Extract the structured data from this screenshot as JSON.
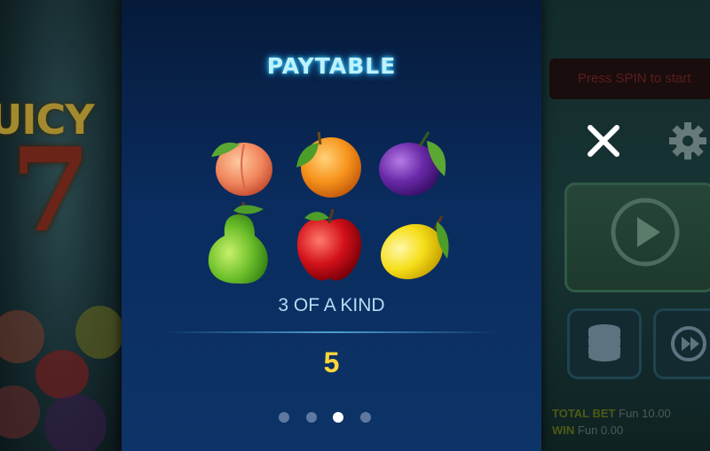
{
  "background": {
    "logo_text": "UICY",
    "logo_number": "7",
    "status_message": "Press SPIN to start",
    "total_bet_label": "TOTAL BET",
    "total_bet_value": "Fun 10.00",
    "win_label": "WIN",
    "win_value": "Fun 0.00"
  },
  "paytable": {
    "title": "PAYTABLE",
    "symbols": [
      "peach",
      "orange",
      "plum",
      "pear",
      "apple",
      "lemon"
    ],
    "combo_label": "3 OF A KIND",
    "payout": "5",
    "pages": 4,
    "current_page": 3
  },
  "colors": {
    "title_glow": "#3ad6ff",
    "payout": "#ffd53b",
    "panel": "#0a2c5e"
  },
  "icons": {
    "close": "close-icon",
    "settings": "gear-icon",
    "spin": "spin-icon",
    "coins": "coin-stack-icon",
    "autoplay": "autoplay-icon"
  }
}
